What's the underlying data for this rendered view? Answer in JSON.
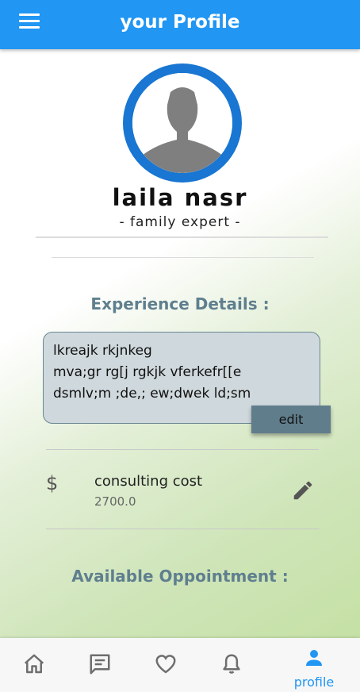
{
  "appbar": {
    "title": "your Profile",
    "menu_icon": "menu-icon"
  },
  "profile": {
    "name": "laila nasr",
    "role": "- family expert -",
    "avatar_color": "#1976d2"
  },
  "experience": {
    "title": "Experience Details :",
    "lines": [
      "lkreajk rkjnkeg",
      "mva;gr rg[j rgkjk vferkefr[[e",
      "dsmlv;m ;de,; ew;dwek ld;sm"
    ],
    "edit_label": "edit"
  },
  "consulting": {
    "label": "consulting cost",
    "value": "2700.0",
    "icon": "dollar-icon",
    "edit_icon": "pencil-icon"
  },
  "appointments": {
    "title": "Available Oppointment :"
  },
  "bottom_nav": {
    "items": [
      {
        "icon": "home-icon"
      },
      {
        "icon": "chat-icon"
      },
      {
        "icon": "heart-icon"
      },
      {
        "icon": "bell-icon"
      },
      {
        "icon": "person-icon",
        "label": "profile",
        "active": true
      }
    ]
  },
  "colors": {
    "primary": "#2196f3",
    "section_title": "#5f7f8f",
    "button": "#607d8b",
    "box": "#cfd8dc"
  }
}
